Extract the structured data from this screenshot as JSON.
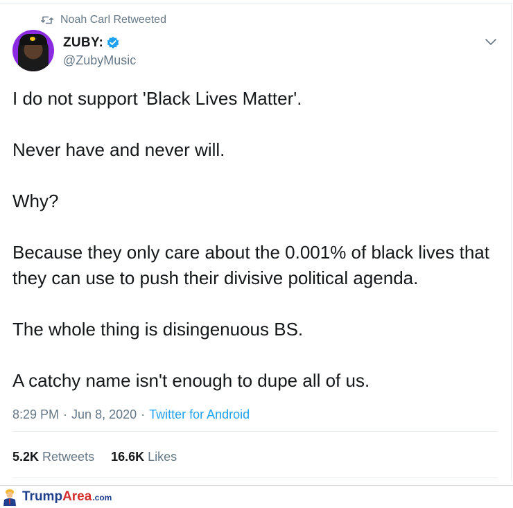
{
  "retweet": {
    "text": "Noah Carl Retweeted",
    "icon": "retweet-icon"
  },
  "author": {
    "display_name": "ZUBY:",
    "handle": "@ZubyMusic",
    "verified": true,
    "avatar_ring_color": "#8a2be2"
  },
  "tweet": {
    "paragraphs": [
      "I do not support 'Black Lives Matter'.",
      "Never have and never will.",
      "Why?",
      "Because they only care about the 0.001% of black lives that they can use to push their divisive political agenda.",
      "The whole thing is disingenuous BS.",
      "A catchy name isn't enough to dupe all of us."
    ],
    "time": "8:29 PM",
    "date": "Jun 8, 2020",
    "separator": "·",
    "source": "Twitter for Android"
  },
  "stats": {
    "retweets_count": "5.2K",
    "retweets_label": "Retweets",
    "likes_count": "16.6K",
    "likes_label": "Likes"
  },
  "watermark": {
    "part1": "Trump",
    "part2": "Area",
    "part3": ".com",
    "colors": {
      "trump": "#1f3f8f",
      "area": "#d32f2f"
    }
  },
  "colors": {
    "accent": "#1da1f2",
    "muted": "#657786",
    "text": "#14171a"
  }
}
